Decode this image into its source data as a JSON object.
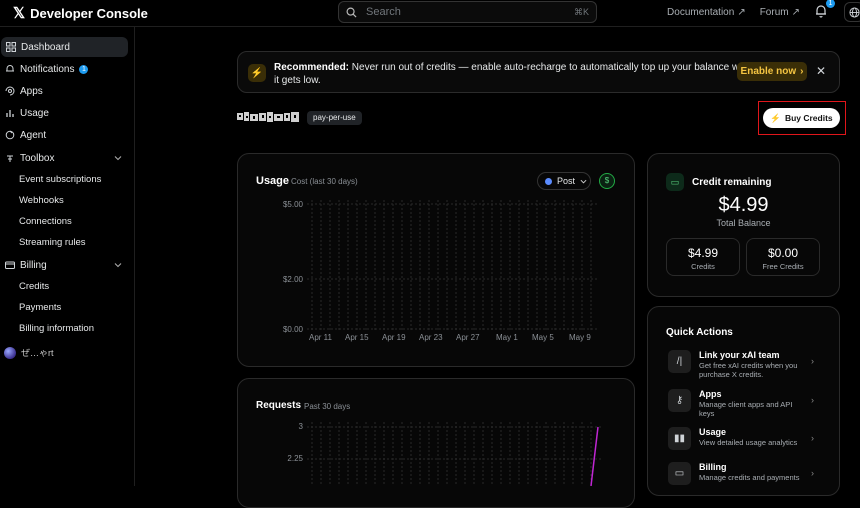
{
  "app": {
    "brand_mark": "𝕏",
    "title": "Developer Console"
  },
  "search": {
    "placeholder": "Search",
    "shortcut": "⌘K"
  },
  "topnav": {
    "documentation": "Documentation",
    "forum": "Forum",
    "notifications_count": "1"
  },
  "sidebar": {
    "dashboard": "Dashboard",
    "notifications": "Notifications",
    "notifications_count": "1",
    "apps": "Apps",
    "usage": "Usage",
    "agent": "Agent",
    "toolbox": "Toolbox",
    "toolbox_items": [
      "Event subscriptions",
      "Webhooks",
      "Connections",
      "Streaming rules"
    ],
    "billing": "Billing",
    "billing_items": [
      "Credits",
      "Payments",
      "Billing information"
    ],
    "user_name": "ぜ…ゃrt"
  },
  "banner": {
    "title": "Recommended:",
    "text": " Never run out of credits — enable auto-recharge to automatically top up your balance when it gets low.",
    "button": "Enable now",
    "close": "✕"
  },
  "account": {
    "plan_badge": "pay-per-use"
  },
  "buy_button": "Buy Credits",
  "usage_card": {
    "title": "Usage",
    "subtitle": "Cost (last 30 days)",
    "filter": "Post",
    "currency_icon": "$",
    "y_ticks": [
      "$5.00",
      "$2.00",
      "$0.00"
    ],
    "x_ticks": [
      "Apr 11",
      "Apr 15",
      "Apr 19",
      "Apr 23",
      "Apr 27",
      "May 1",
      "May 5",
      "May 9"
    ]
  },
  "credit_card": {
    "title": "Credit remaining",
    "amount": "$4.99",
    "amount_label": "Total Balance",
    "credits_value": "$4.99",
    "credits_label": "Credits",
    "free_value": "$0.00",
    "free_label": "Free Credits"
  },
  "quick_actions": {
    "title": "Quick Actions",
    "items": [
      {
        "title": "Link your xAI team",
        "desc": "Get free xAI credits when you purchase X credits.",
        "icon": "xai-icon"
      },
      {
        "title": "Apps",
        "desc": "Manage client apps and API keys",
        "icon": "key-icon"
      },
      {
        "title": "Usage",
        "desc": "View detailed usage analytics",
        "icon": "bar-chart-icon"
      },
      {
        "title": "Billing",
        "desc": "Manage credits and payments",
        "icon": "card-icon"
      }
    ]
  },
  "requests_card": {
    "title": "Requests",
    "subtitle": "Past 30 days",
    "y_ticks": [
      "3",
      "2.25"
    ]
  },
  "colors": {
    "accent": "#1d9bf0",
    "warning": "#f5c542",
    "success": "#59d27f",
    "highlight_outline": "#e0161b",
    "request_line": "#c026d3"
  }
}
